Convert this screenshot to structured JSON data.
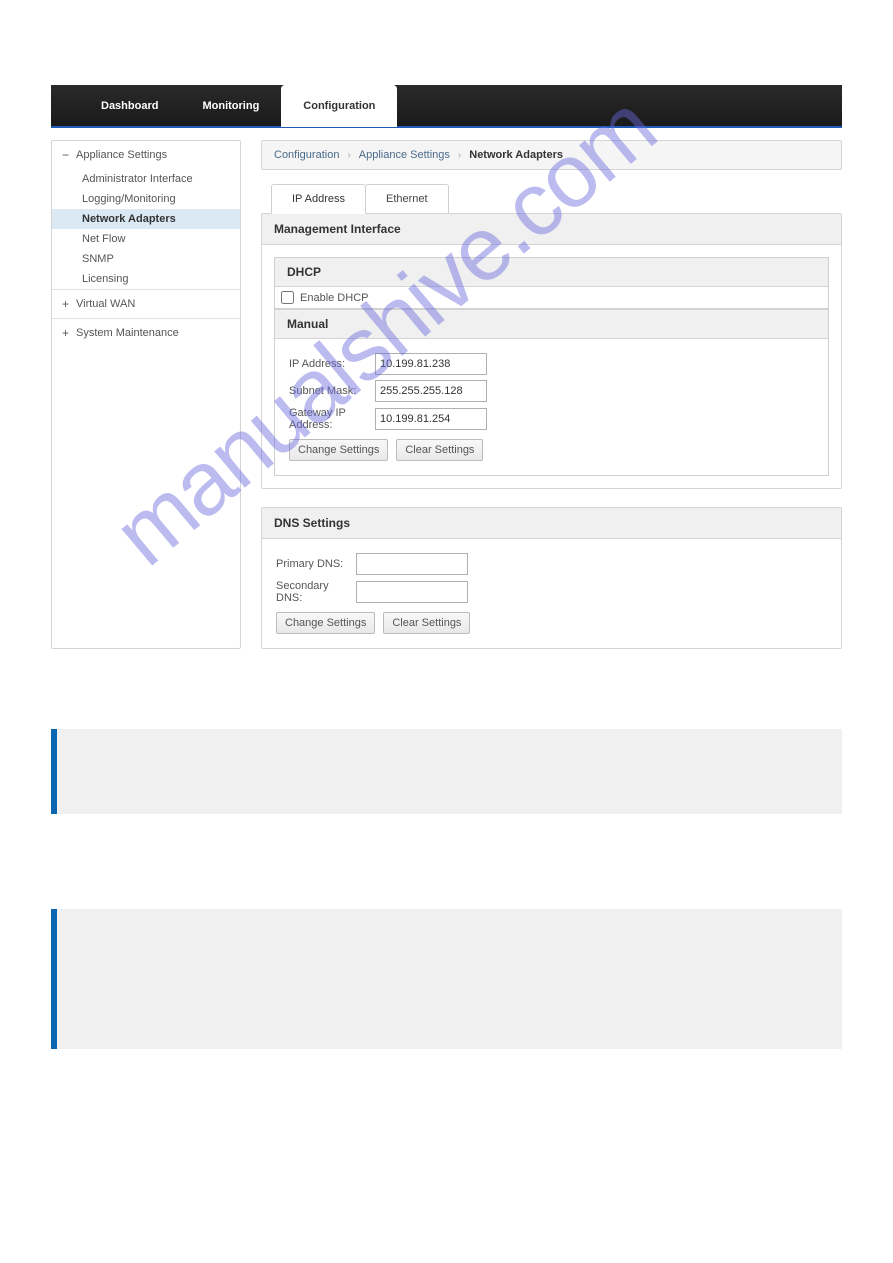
{
  "topnav": {
    "items": [
      {
        "label": "Dashboard",
        "active": false
      },
      {
        "label": "Monitoring",
        "active": false
      },
      {
        "label": "Configuration",
        "active": true
      }
    ]
  },
  "sidebar": {
    "sections": [
      {
        "label": "Appliance Settings",
        "expanded": true,
        "items": [
          {
            "label": "Administrator Interface",
            "active": false
          },
          {
            "label": "Logging/Monitoring",
            "active": false
          },
          {
            "label": "Network Adapters",
            "active": true
          },
          {
            "label": "Net Flow",
            "active": false
          },
          {
            "label": "SNMP",
            "active": false
          },
          {
            "label": "Licensing",
            "active": false
          }
        ]
      },
      {
        "label": "Virtual WAN",
        "expanded": false,
        "items": []
      },
      {
        "label": "System Maintenance",
        "expanded": false,
        "items": []
      }
    ]
  },
  "breadcrumb": {
    "items": [
      "Configuration",
      "Appliance Settings",
      "Network Adapters"
    ]
  },
  "tabs": [
    {
      "label": "IP Address",
      "active": true
    },
    {
      "label": "Ethernet",
      "active": false
    }
  ],
  "management": {
    "title": "Management Interface",
    "dhcp": {
      "title": "DHCP",
      "checkbox_label": "Enable DHCP",
      "checked": false
    },
    "manual": {
      "title": "Manual",
      "ip_label": "IP Address:",
      "ip_value": "10.199.81.238",
      "subnet_label": "Subnet Mask:",
      "subnet_value": "255.255.255.128",
      "gateway_label": "Gateway IP Address:",
      "gateway_value": "10.199.81.254",
      "change_btn": "Change Settings",
      "clear_btn": "Clear Settings"
    }
  },
  "dns": {
    "title": "DNS Settings",
    "primary_label": "Primary DNS:",
    "primary_value": "",
    "secondary_label": "Secondary DNS:",
    "secondary_value": "",
    "change_btn": "Change Settings",
    "clear_btn": "Clear Settings"
  },
  "watermark": "manualshive.com"
}
